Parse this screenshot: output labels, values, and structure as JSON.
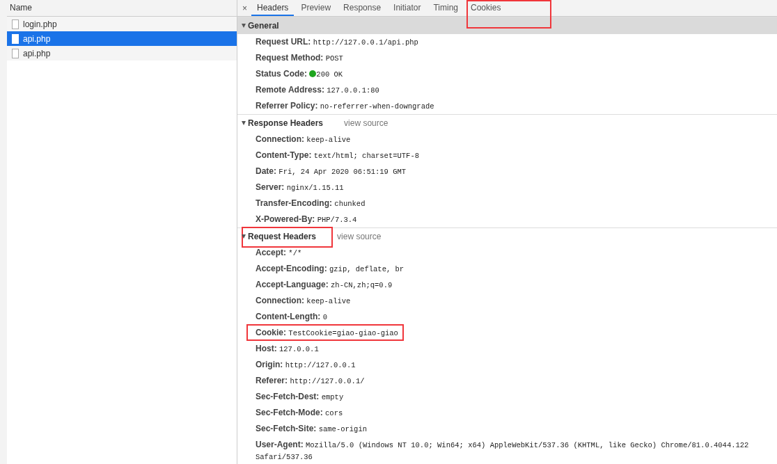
{
  "request_list": {
    "column": "Name",
    "items": [
      {
        "name": "login.php",
        "selected": false
      },
      {
        "name": "api.php",
        "selected": true
      },
      {
        "name": "api.php",
        "selected": false
      }
    ]
  },
  "close_label": "×",
  "tabs": [
    {
      "label": "Headers",
      "selected": true,
      "highlighted": false
    },
    {
      "label": "Preview",
      "selected": false,
      "highlighted": false
    },
    {
      "label": "Response",
      "selected": false,
      "highlighted": false
    },
    {
      "label": "Initiator",
      "selected": false,
      "highlighted": false
    },
    {
      "label": "Timing",
      "selected": false,
      "highlighted": false
    },
    {
      "label": "Cookies",
      "selected": false,
      "highlighted": true
    }
  ],
  "sections": [
    {
      "title": "General",
      "expanded": true,
      "focused": true,
      "highlighted": false,
      "rows": [
        {
          "name": "Request URL:",
          "value": "http://127.0.0.1/api.php",
          "highlighted": false
        },
        {
          "name": "Request Method:",
          "value": "POST",
          "highlighted": false
        },
        {
          "name": "Status Code:",
          "value": "200 OK",
          "status_dot": true,
          "highlighted": false
        },
        {
          "name": "Remote Address:",
          "value": "127.0.0.1:80",
          "highlighted": false
        },
        {
          "name": "Referrer Policy:",
          "value": "no-referrer-when-downgrade",
          "highlighted": false
        }
      ]
    },
    {
      "title": "Response Headers",
      "link": "view source",
      "expanded": true,
      "focused": false,
      "highlighted": false,
      "rows": [
        {
          "name": "Connection:",
          "value": "keep-alive",
          "highlighted": false
        },
        {
          "name": "Content-Type:",
          "value": "text/html; charset=UTF-8",
          "highlighted": false
        },
        {
          "name": "Date:",
          "value": "Fri, 24 Apr 2020 06:51:19 GMT",
          "highlighted": false
        },
        {
          "name": "Server:",
          "value": "nginx/1.15.11",
          "highlighted": false
        },
        {
          "name": "Transfer-Encoding:",
          "value": "chunked",
          "highlighted": false
        },
        {
          "name": "X-Powered-By:",
          "value": "PHP/7.3.4",
          "highlighted": false
        }
      ]
    },
    {
      "title": "Request Headers",
      "link": "view source",
      "expanded": true,
      "focused": false,
      "highlighted": true,
      "rows": [
        {
          "name": "Accept:",
          "value": "*/*",
          "highlighted": false
        },
        {
          "name": "Accept-Encoding:",
          "value": "gzip, deflate, br",
          "highlighted": false
        },
        {
          "name": "Accept-Language:",
          "value": "zh-CN,zh;q=0.9",
          "highlighted": false
        },
        {
          "name": "Connection:",
          "value": "keep-alive",
          "highlighted": false
        },
        {
          "name": "Content-Length:",
          "value": "0",
          "highlighted": false
        },
        {
          "name": "Cookie:",
          "value": "TestCookie=giao-giao-giao",
          "highlighted": true
        },
        {
          "name": "Host:",
          "value": "127.0.0.1",
          "highlighted": false
        },
        {
          "name": "Origin:",
          "value": "http://127.0.0.1",
          "highlighted": false
        },
        {
          "name": "Referer:",
          "value": "http://127.0.0.1/",
          "highlighted": false
        },
        {
          "name": "Sec-Fetch-Dest:",
          "value": "empty",
          "highlighted": false
        },
        {
          "name": "Sec-Fetch-Mode:",
          "value": "cors",
          "highlighted": false
        },
        {
          "name": "Sec-Fetch-Site:",
          "value": "same-origin",
          "highlighted": false
        },
        {
          "name": "User-Agent:",
          "value": "Mozilla/5.0 (Windows NT 10.0; Win64; x64) AppleWebKit/537.36 (KHTML, like Gecko) Chrome/81.0.4044.122 Safari/537.36",
          "highlighted": false
        }
      ]
    }
  ]
}
